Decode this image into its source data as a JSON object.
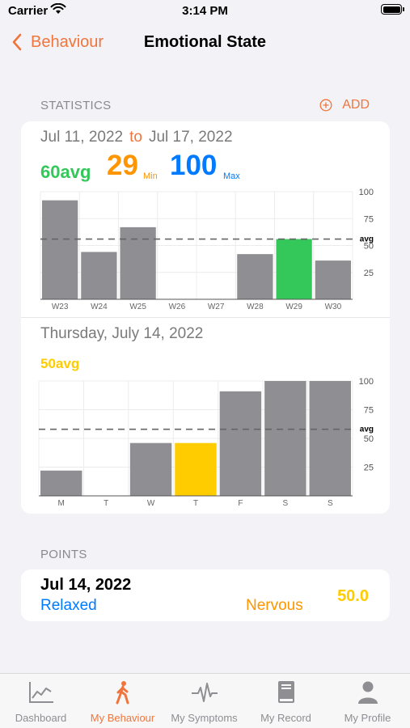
{
  "status_bar": {
    "carrier": "Carrier",
    "time": "3:14 PM"
  },
  "nav": {
    "back_label": "Behaviour",
    "title": "Emotional State"
  },
  "statistics": {
    "header": "STATISTICS",
    "add_label": "ADD",
    "range_start": "Jul 11, 2022",
    "range_to": "to",
    "range_end": "Jul 17, 2022",
    "avg_label": "60avg",
    "min_value": "29",
    "min_label": "Min",
    "max_value": "100",
    "max_label": "Max",
    "day_title": "Thursday, July 14, 2022",
    "day_avg_label": "50avg"
  },
  "chart_data": [
    {
      "type": "bar",
      "categories": [
        "W23",
        "W24",
        "W25",
        "W26",
        "W27",
        "W28",
        "W29",
        "W30"
      ],
      "values": [
        92,
        44,
        67,
        null,
        null,
        42,
        56,
        36
      ],
      "highlight_index": 6,
      "highlight_color": "#34c759",
      "bar_color": "#8e8e93",
      "avg_line": 56,
      "avg_label": "avg",
      "yticks": [
        25,
        50,
        75,
        100
      ],
      "ylim": [
        0,
        100
      ],
      "grid": true
    },
    {
      "type": "bar",
      "categories": [
        "M",
        "T",
        "W",
        "T",
        "F",
        "S",
        "S"
      ],
      "values": [
        22,
        null,
        46,
        46,
        91,
        100,
        100
      ],
      "highlight_index": 3,
      "highlight_color": "#ffcc00",
      "bar_color": "#8e8e93",
      "avg_line": 58,
      "avg_label": "avg",
      "yticks": [
        25,
        50,
        75,
        100
      ],
      "ylim": [
        0,
        100
      ],
      "grid": true
    }
  ],
  "points": {
    "header": "POINTS",
    "entry": {
      "date": "Jul 14, 2022",
      "left_label": "Relaxed",
      "right_label": "Nervous",
      "value": "50.0"
    }
  },
  "tabs": [
    {
      "label": "Dashboard",
      "icon": "chart-line-icon",
      "active": false
    },
    {
      "label": "My Behaviour",
      "icon": "walking-icon",
      "active": true
    },
    {
      "label": "My Symptoms",
      "icon": "pulse-icon",
      "active": false
    },
    {
      "label": "My Record",
      "icon": "book-icon",
      "active": false
    },
    {
      "label": "My Profile",
      "icon": "person-icon",
      "active": false
    }
  ],
  "colors": {
    "accent": "#f0753c",
    "inactive_tab": "#8e8e93"
  }
}
